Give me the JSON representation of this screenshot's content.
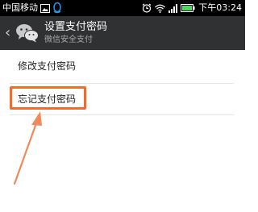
{
  "status_bar": {
    "carrier": "中国移动",
    "time": "下午03:24"
  },
  "title_bar": {
    "title": "设置支付密码",
    "subtitle": "微信安全支付"
  },
  "menu": {
    "items": [
      {
        "label": "修改支付密码"
      },
      {
        "label": "忘记支付密码"
      }
    ]
  },
  "colors": {
    "status_bar_bg": "#000000",
    "title_bar_bg": "#2f3133",
    "highlight": "#f26b2c",
    "qq_icon": "#1e9bf0"
  },
  "icons": [
    "image-icon",
    "qq-penguin-icon",
    "alarm-icon",
    "wifi-icon",
    "signal-icon",
    "battery-icon",
    "back-arrow-icon",
    "wechat-logo-icon",
    "annotation-arrow-icon"
  ]
}
